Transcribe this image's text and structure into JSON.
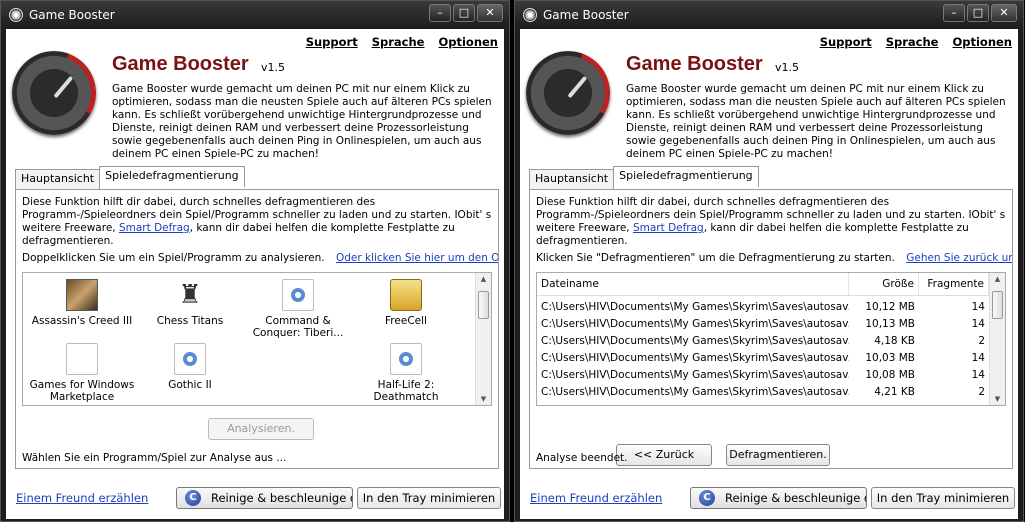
{
  "left": {
    "title": "Game Booster",
    "links": [
      "Support",
      "Sprache",
      "Optionen"
    ],
    "app_name": "Game Booster",
    "version": "v1.5",
    "description": "Game Booster wurde gemacht um deinen PC mit nur einem Klick zu optimieren, sodass man die neusten Spiele auch auf älteren PCs spielen kann. Es schließt vorübergehend unwichtige Hintergrundprozesse und Dienste, reinigt deinen RAM und verbessert deine Prozessorleistung sowie gegebenenfalls auch deinen Ping in Onlinespielen, um auch aus deinem PC einen Spiele-PC zu machen!",
    "tabs": [
      "Hauptansicht",
      "Spieledefragmentierung"
    ],
    "panel_text_1": "Diese Funktion hilft dir dabei, durch schnelles defragmentieren des Programm-/Spieleordners dein Spiel/Programm schneller zu laden und zu starten. IObit' s weitere Freeware,",
    "panel_link": "Smart Defrag",
    "panel_text_2": ", kann dir dabei helfen die komplette Festplatte zu defragmentieren.",
    "instruction": "Doppelklicken Sie um ein Spiel/Programm zu analysieren.",
    "instruction_link": "Oder klicken Sie hier um den Ordner auszu",
    "games": [
      {
        "name": "Assassin's Creed III",
        "icon": "assassins-creed-icon"
      },
      {
        "name": "Chess Titans",
        "icon": "chess-icon"
      },
      {
        "name": "Command & Conquer: Tiberi...",
        "icon": "exe-icon"
      },
      {
        "name": "FreeCell",
        "icon": "freecell-icon"
      },
      {
        "name": "Games for Windows Marketplace",
        "icon": "document-icon"
      },
      {
        "name": "Gothic II",
        "icon": "exe-icon"
      },
      {
        "name": "Half-Life 2: Deathmatch",
        "icon": "exe-icon"
      }
    ],
    "analyze_button": "Analysieren.",
    "status": "Wählen Sie ein Programm/Spiel zur Analyse aus ...",
    "footer_link": "Einem Freund erzählen",
    "clean_button": "Reinige & beschleunige de",
    "tray_button": "In den Tray minimieren"
  },
  "right": {
    "title": "Game Booster",
    "links": [
      "Support",
      "Sprache",
      "Optionen"
    ],
    "app_name": "Game Booster",
    "version": "v1.5",
    "description": "Game Booster wurde gemacht um deinen PC mit nur einem Klick zu optimieren, sodass man die neusten Spiele auch auf älteren PCs spielen kann. Es schließt vorübergehend unwichtige Hintergrundprozesse und Dienste, reinigt deinen RAM und verbessert deine Prozessorleistung sowie gegebenenfalls auch deinen Ping in Onlinespielen, um auch aus deinem PC einen Spiele-PC zu machen!",
    "tabs": [
      "Hauptansicht",
      "Spieledefragmentierung"
    ],
    "panel_text_1": "Diese Funktion hilft dir dabei, durch schnelles defragmentieren des Programm-/Spieleordners dein Spiel/Programm schneller zu laden und zu starten. IObit' s weitere Freeware,",
    "panel_link": "Smart Defrag",
    "panel_text_2": ", kann dir dabei helfen die komplette Festplatte zu defragmentieren.",
    "instruction": "Klicken Sie \"Defragmentieren\" um die Defragmentierung zu starten.",
    "instruction_link": "Gehen Sie zurück um ein ander",
    "columns": [
      "Dateiname",
      "Größe",
      "Fragmente"
    ],
    "rows": [
      [
        "C:\\Users\\HIV\\Documents\\My Games\\Skyrim\\Saves\\autosav...",
        "10,12 MB",
        "14"
      ],
      [
        "C:\\Users\\HIV\\Documents\\My Games\\Skyrim\\Saves\\autosav...",
        "10,13 MB",
        "14"
      ],
      [
        "C:\\Users\\HIV\\Documents\\My Games\\Skyrim\\Saves\\autosav...",
        "4,18 KB",
        "2"
      ],
      [
        "C:\\Users\\HIV\\Documents\\My Games\\Skyrim\\Saves\\autosav...",
        "10,03 MB",
        "14"
      ],
      [
        "C:\\Users\\HIV\\Documents\\My Games\\Skyrim\\Saves\\autosav...",
        "10,08 MB",
        "14"
      ],
      [
        "C:\\Users\\HIV\\Documents\\My Games\\Skyrim\\Saves\\autosav...",
        "4,21 KB",
        "2"
      ]
    ],
    "back_button": "<< Zurück",
    "defrag_button": "Defragmentieren.",
    "status": "Analyse beendet.",
    "footer_link": "Einem Freund erzählen",
    "clean_button": "Reinige & beschleunige de",
    "tray_button": "In den Tray minimieren"
  },
  "window_buttons": [
    "–",
    "□",
    "✕"
  ],
  "colors": {
    "app_title": "#7a1212",
    "link": "#1a3fc0",
    "gauge_red": "#c0201e"
  }
}
